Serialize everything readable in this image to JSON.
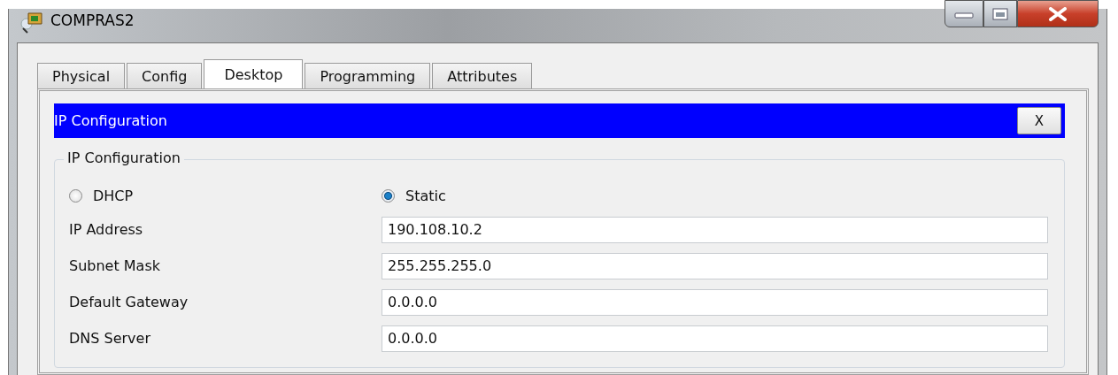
{
  "window": {
    "title": "COMPRAS2"
  },
  "tabs": [
    {
      "label": "Physical",
      "selected": false
    },
    {
      "label": "Config",
      "selected": false
    },
    {
      "label": "Desktop",
      "selected": true
    },
    {
      "label": "Programming",
      "selected": false
    },
    {
      "label": "Attributes",
      "selected": false
    }
  ],
  "dialog": {
    "title": "IP Configuration",
    "close_label": "X",
    "group_title": "IP Configuration",
    "modes": [
      {
        "label": "DHCP",
        "selected": false
      },
      {
        "label": "Static",
        "selected": true
      }
    ],
    "fields": [
      {
        "label": "IP Address",
        "value": "190.108.10.2"
      },
      {
        "label": "Subnet Mask",
        "value": "255.255.255.0"
      },
      {
        "label": "Default Gateway",
        "value": "0.0.0.0"
      },
      {
        "label": "DNS Server",
        "value": "0.0.0.0"
      }
    ]
  }
}
